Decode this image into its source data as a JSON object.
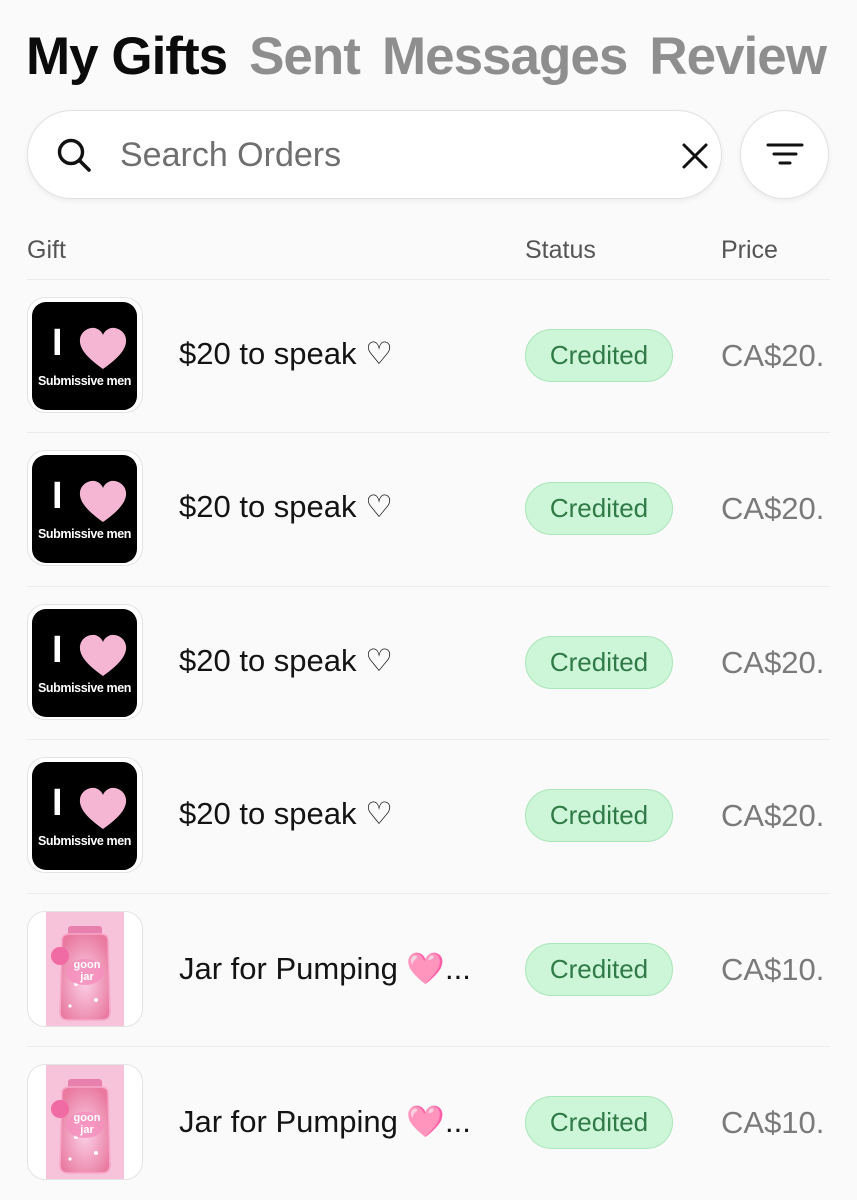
{
  "tabs": [
    {
      "label": "My Gifts",
      "active": true
    },
    {
      "label": "Sent",
      "active": false
    },
    {
      "label": "Messages",
      "active": false
    },
    {
      "label": "Review",
      "active": false
    }
  ],
  "search": {
    "placeholder": "Search Orders",
    "value": ""
  },
  "table": {
    "headers": {
      "gift": "Gift",
      "status": "Status",
      "price": "Price"
    },
    "rows": [
      {
        "thumb": {
          "type": "i-heart",
          "letter": "I",
          "caption": "Submissive men"
        },
        "name": "$20 to speak ♡",
        "status": "Credited",
        "price": "CA$20."
      },
      {
        "thumb": {
          "type": "i-heart",
          "letter": "I",
          "caption": "Submissive men"
        },
        "name": "$20 to speak ♡",
        "status": "Credited",
        "price": "CA$20."
      },
      {
        "thumb": {
          "type": "i-heart",
          "letter": "I",
          "caption": "Submissive men"
        },
        "name": "$20 to speak ♡",
        "status": "Credited",
        "price": "CA$20."
      },
      {
        "thumb": {
          "type": "i-heart",
          "letter": "I",
          "caption": "Submissive men"
        },
        "name": "$20 to speak ♡",
        "status": "Credited",
        "price": "CA$20."
      },
      {
        "thumb": {
          "type": "jar",
          "label": "goon jar"
        },
        "name": "Jar for Pumping 🩷...",
        "status": "Credited",
        "price": "CA$10."
      },
      {
        "thumb": {
          "type": "jar",
          "label": "goon jar"
        },
        "name": "Jar for Pumping 🩷...",
        "status": "Credited",
        "price": "CA$10."
      }
    ]
  },
  "colors": {
    "status_bg": "#cdf5d7",
    "status_text": "#2f7a47",
    "heart_pink": "#f5b6d3",
    "jar_pink": "#f28fc2"
  },
  "icons": [
    "search-icon",
    "close-icon",
    "filter-icon",
    "heart-icon"
  ]
}
